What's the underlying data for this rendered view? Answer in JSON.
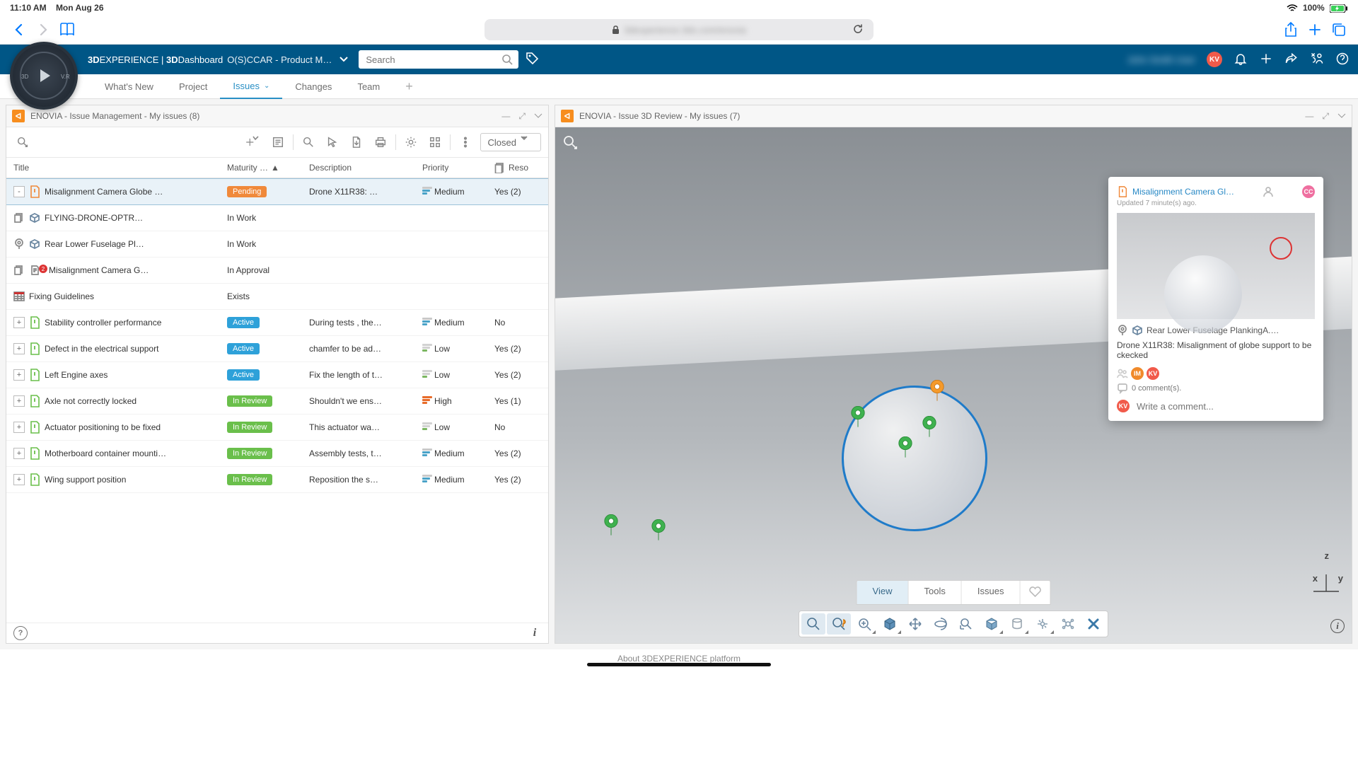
{
  "statusbar": {
    "time": "11:10 AM",
    "date": "Mon Aug 26",
    "battery": "100%"
  },
  "browser": {
    "url_masked": "— — — —"
  },
  "header": {
    "brand_a": "3D",
    "brand_b": "EXPERIENCE",
    "brand_sep": " | ",
    "brand_c": "3D",
    "brand_d": "Dashboard",
    "crumb": "O(S)CCAR - Product M…",
    "search_placeholder": "Search",
    "avatar": "KV"
  },
  "tabs": [
    {
      "label": "What's New",
      "active": false
    },
    {
      "label": "Project",
      "active": false
    },
    {
      "label": "Issues",
      "active": true,
      "has_caret": true
    },
    {
      "label": "Changes",
      "active": false
    },
    {
      "label": "Team",
      "active": false
    }
  ],
  "leftPanel": {
    "title": "ENOVIA - Issue Management - My issues (8)",
    "filter": "Closed",
    "columns": {
      "title": "Title",
      "maturity": "Maturity …",
      "desc": "Description",
      "priority": "Priority",
      "reso": "Reso"
    },
    "rows": [
      {
        "type": "issue",
        "expander": "-",
        "selected": true,
        "doc": "orange",
        "title": "Misalignment Camera Globe …",
        "pill": "Pending",
        "pillClass": "pending",
        "desc": "Drone X11R38: …",
        "priority": "Medium",
        "reso": "Yes (2)"
      },
      {
        "type": "child",
        "indent": 1,
        "icons": [
          "copy",
          "cube"
        ],
        "title": "FLYING-DRONE-OPTR…",
        "mat_text": "In Work"
      },
      {
        "type": "child",
        "indent": 1,
        "icons": [
          "pin",
          "cube"
        ],
        "title": "Rear Lower Fuselage Pl…",
        "mat_text": "In Work"
      },
      {
        "type": "child",
        "indent": 1,
        "icons": [
          "doc2",
          "doc"
        ],
        "title": "Misalignment Camera G…",
        "mat_text": "In Approval",
        "badge": "2"
      },
      {
        "type": "child",
        "indent": 2,
        "icons": [
          "table"
        ],
        "title": "Fixing Guidelines",
        "mat_text": "Exists"
      },
      {
        "type": "issue",
        "expander": "+",
        "doc": "green",
        "title": "Stability controller performance",
        "pill": "Active",
        "pillClass": "active",
        "desc": "During tests , the…",
        "priority": "Medium",
        "reso": "No"
      },
      {
        "type": "issue",
        "expander": "+",
        "doc": "green",
        "title": "Defect in the electrical support",
        "pill": "Active",
        "pillClass": "active",
        "desc": "chamfer to be ad…",
        "priority": "Low",
        "reso": "Yes (2)"
      },
      {
        "type": "issue",
        "expander": "+",
        "doc": "green",
        "title": "Left Engine axes",
        "pill": "Active",
        "pillClass": "active",
        "desc": "Fix the length of t…",
        "priority": "Low",
        "reso": "Yes (2)"
      },
      {
        "type": "issue",
        "expander": "+",
        "doc": "green",
        "title": "Axle not correctly locked",
        "pill": "In Review",
        "pillClass": "review",
        "desc": "Shouldn't we ens…",
        "priority": "High",
        "reso": "Yes (1)"
      },
      {
        "type": "issue",
        "expander": "+",
        "doc": "green",
        "title": "Actuator positioning  to be fixed",
        "pill": "In Review",
        "pillClass": "review",
        "desc": "This actuator wa…",
        "priority": "Low",
        "reso": "No"
      },
      {
        "type": "issue",
        "expander": "+",
        "doc": "green",
        "title": "Motherboard container mounti…",
        "pill": "In Review",
        "pillClass": "review",
        "desc": "Assembly tests, t…",
        "priority": "Medium",
        "reso": "Yes (2)"
      },
      {
        "type": "issue",
        "expander": "+",
        "doc": "green",
        "title": "Wing support position",
        "pill": "In Review",
        "pillClass": "review",
        "desc": "Reposition the s…",
        "priority": "Medium",
        "reso": "Yes (2)"
      }
    ]
  },
  "rightPanel": {
    "title": "ENOVIA - Issue 3D Review - My issues (7)",
    "viewTabs": [
      {
        "label": "View",
        "active": true
      },
      {
        "label": "Tools",
        "active": false
      },
      {
        "label": "Issues",
        "active": false
      }
    ],
    "card": {
      "title": "Misalignment Camera Gl…",
      "avatar": "CC",
      "subtitle": "Updated 7 minute(s) ago.",
      "location": "Rear Lower Fuselage PlankingA.…",
      "description": "Drone X11R38: Misalignment of globe support to be ckecked",
      "people": [
        "IM",
        "KV"
      ],
      "comments": "0 comment(s).",
      "comment_avatar": "KV",
      "comment_placeholder": "Write a comment..."
    },
    "axes": {
      "x": "x",
      "y": "y",
      "z": "z"
    }
  },
  "footer": {
    "about": "About 3DEXPERIENCE platform"
  },
  "colors": {
    "pending": "#f0893a",
    "active": "#2ea1d9",
    "review": "#6abf4b",
    "avatar_kv": "#f15a4a",
    "avatar_cc": "#ef6fa0",
    "avatar_im": "#f08a2b"
  }
}
